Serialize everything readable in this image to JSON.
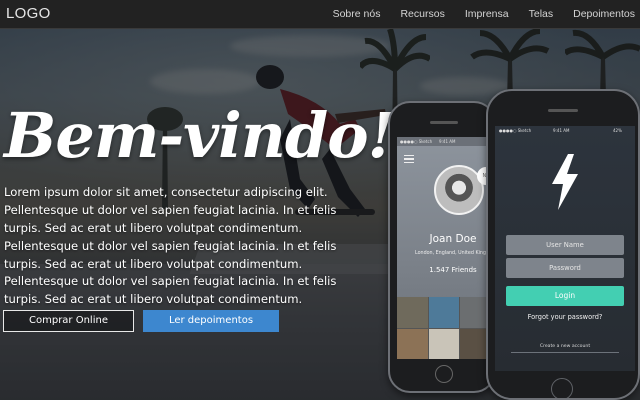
{
  "navbar": {
    "logo": "LOGO",
    "links": [
      "Sobre nós",
      "Recursos",
      "Imprensa",
      "Telas",
      "Depoimentos"
    ]
  },
  "hero": {
    "headline": "Bem-vindo!",
    "paragraph_1": "Lorem ipsum dolor sit amet, consectetur adipiscing elit. Pellentesque ut dolor vel sapien feugiat lacinia. In et felis turpis. Sed ac erat ut libero volutpat condimentum. Pellentesque ut dolor vel sapien feugiat lacinia. In et felis turpis. Sed ac erat ut libero volutpat condimentum.",
    "paragraph_2": "Pellentesque ut dolor vel sapien feugiat lacinia. In et felis turpis. Sed ac erat ut libero volutpat condimentum.",
    "button_buy": "Comprar Online",
    "button_testimonials": "Ler depoimentos"
  },
  "phone_profile": {
    "status_left": "●●●●○ Sketch",
    "status_time": "9:41 AM",
    "badge": "NE",
    "name": "Joan Doe",
    "location": "London, England, United Kingdom",
    "friends": "1.547 Friends"
  },
  "phone_login": {
    "status_left": "●●●●○ Sketch",
    "status_time": "9:41 AM",
    "status_right": "42%",
    "username_placeholder": "User Name",
    "password_placeholder": "Password",
    "login_label": "Login",
    "forgot_label": "Forgot your password?",
    "create_label": "Create a new account"
  },
  "colors": {
    "navbar_bg": "#222222",
    "primary_button": "#3d87cf",
    "login_button": "#43cfb2"
  },
  "icons": [
    "hamburger-icon",
    "lightning-bolt-icon"
  ]
}
